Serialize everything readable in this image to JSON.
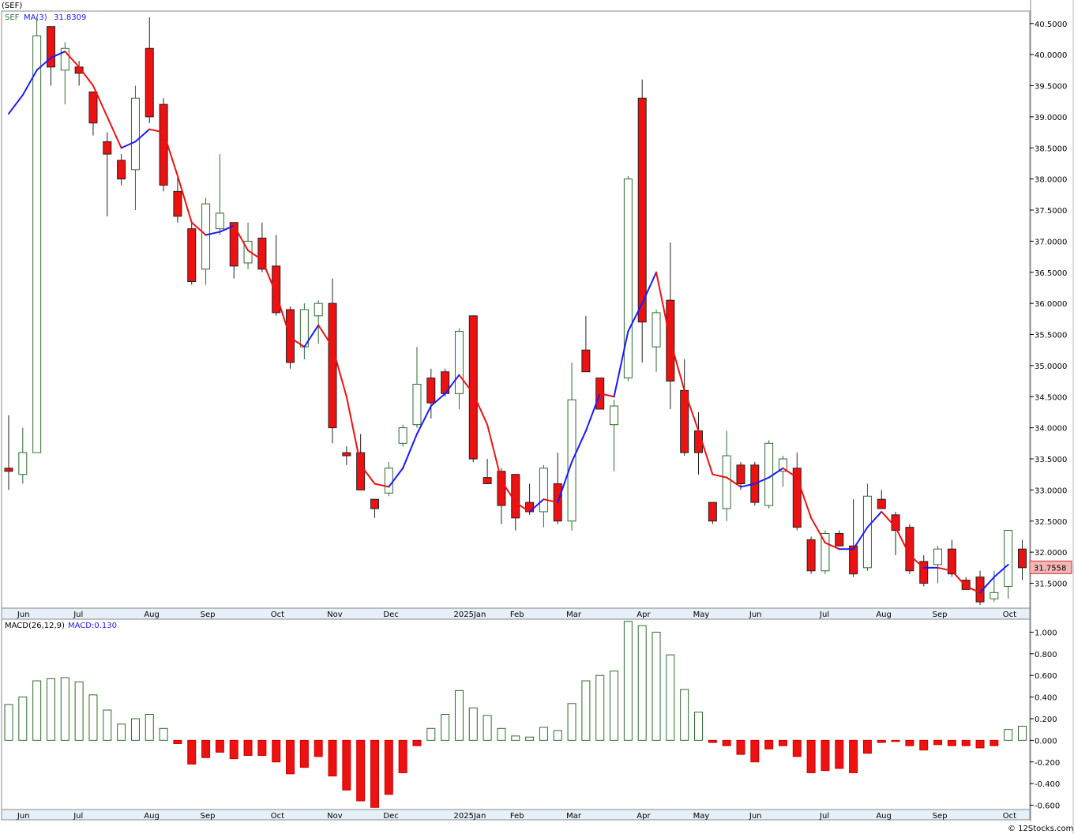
{
  "chart_data": [
    {
      "type": "candlestick",
      "title": "(SEF)",
      "legend": [
        {
          "text": "SEF",
          "color": "#2e7d32"
        },
        {
          "text": "MA(3)",
          "color": "#1a1aff"
        },
        {
          "text": "31.8309",
          "color": "#1a1aff"
        }
      ],
      "last_price_label": "31.7558",
      "last_price": 31.7558,
      "ylim": [
        31.1,
        40.7
      ],
      "y_ticks": [
        "40.5000",
        "40.0000",
        "39.5000",
        "39.0000",
        "38.5000",
        "38.0000",
        "37.5000",
        "37.0000",
        "36.5000",
        "36.0000",
        "35.5000",
        "35.0000",
        "34.5000",
        "34.0000",
        "33.5000",
        "33.0000",
        "32.5000",
        "32.0000",
        "31.5000"
      ],
      "y_tick_values": [
        40.5,
        40.0,
        39.5,
        39.0,
        38.5,
        38.0,
        37.5,
        37.0,
        36.5,
        36.0,
        35.5,
        35.0,
        34.5,
        34.0,
        33.5,
        33.0,
        32.5,
        32.0,
        31.5
      ],
      "x_labels": [
        "Jun",
        "Jul",
        "Aug",
        "Sep",
        "Oct",
        "Nov",
        "Dec",
        "2025Jan",
        "Feb",
        "Mar",
        "Apr",
        "May",
        "Jun",
        "Jul",
        "Aug",
        "Sep",
        "Oct"
      ],
      "x_label_index": [
        1,
        5,
        10,
        14,
        19,
        23,
        27,
        32,
        36,
        40,
        45,
        49,
        53,
        58,
        62,
        66,
        71
      ],
      "candles": [
        {
          "o": 33.35,
          "h": 34.2,
          "l": 33.0,
          "c": 33.3
        },
        {
          "o": 33.25,
          "h": 34.0,
          "l": 33.1,
          "c": 33.6
        },
        {
          "o": 33.6,
          "h": 40.6,
          "l": 39.6,
          "c": 40.3
        },
        {
          "o": 40.45,
          "h": 40.45,
          "l": 39.5,
          "c": 39.8
        },
        {
          "o": 39.75,
          "h": 40.2,
          "l": 39.2,
          "c": 40.1
        },
        {
          "o": 39.8,
          "h": 39.9,
          "l": 39.5,
          "c": 39.7
        },
        {
          "o": 39.4,
          "h": 39.4,
          "l": 38.7,
          "c": 38.9
        },
        {
          "o": 38.6,
          "h": 38.75,
          "l": 37.4,
          "c": 38.4
        },
        {
          "o": 38.3,
          "h": 38.4,
          "l": 37.9,
          "c": 38.0
        },
        {
          "o": 38.15,
          "h": 39.5,
          "l": 37.5,
          "c": 39.3
        },
        {
          "o": 40.1,
          "h": 40.6,
          "l": 38.9,
          "c": 39.0
        },
        {
          "o": 39.2,
          "h": 39.3,
          "l": 37.8,
          "c": 37.9
        },
        {
          "o": 37.8,
          "h": 38.05,
          "l": 37.3,
          "c": 37.4
        },
        {
          "o": 37.2,
          "h": 37.3,
          "l": 36.3,
          "c": 36.35
        },
        {
          "o": 36.55,
          "h": 37.7,
          "l": 36.3,
          "c": 37.6
        },
        {
          "o": 37.2,
          "h": 38.4,
          "l": 37.1,
          "c": 37.45
        },
        {
          "o": 37.3,
          "h": 37.3,
          "l": 36.4,
          "c": 36.6
        },
        {
          "o": 36.65,
          "h": 37.3,
          "l": 36.55,
          "c": 37.0
        },
        {
          "o": 37.05,
          "h": 37.3,
          "l": 36.5,
          "c": 36.55
        },
        {
          "o": 36.6,
          "h": 37.1,
          "l": 35.8,
          "c": 35.85
        },
        {
          "o": 35.9,
          "h": 35.95,
          "l": 34.95,
          "c": 35.05
        },
        {
          "o": 35.3,
          "h": 36.0,
          "l": 35.1,
          "c": 35.9
        },
        {
          "o": 35.8,
          "h": 36.05,
          "l": 35.35,
          "c": 36.0
        },
        {
          "o": 36.0,
          "h": 36.4,
          "l": 33.75,
          "c": 34.0
        },
        {
          "o": 33.6,
          "h": 33.7,
          "l": 33.4,
          "c": 33.55
        },
        {
          "o": 33.6,
          "h": 33.9,
          "l": 33.0,
          "c": 33.0
        },
        {
          "o": 32.85,
          "h": 32.85,
          "l": 32.55,
          "c": 32.7
        },
        {
          "o": 32.95,
          "h": 33.45,
          "l": 32.9,
          "c": 33.35
        },
        {
          "o": 33.75,
          "h": 34.05,
          "l": 33.7,
          "c": 34.0
        },
        {
          "o": 34.05,
          "h": 35.3,
          "l": 34.0,
          "c": 34.7
        },
        {
          "o": 34.8,
          "h": 34.95,
          "l": 34.15,
          "c": 34.4
        },
        {
          "o": 34.9,
          "h": 34.95,
          "l": 34.5,
          "c": 34.55
        },
        {
          "o": 34.55,
          "h": 35.6,
          "l": 34.3,
          "c": 35.55
        },
        {
          "o": 35.8,
          "h": 35.8,
          "l": 33.45,
          "c": 33.5
        },
        {
          "o": 33.2,
          "h": 33.5,
          "l": 33.1,
          "c": 33.1
        },
        {
          "o": 33.3,
          "h": 33.35,
          "l": 32.45,
          "c": 32.75
        },
        {
          "o": 33.25,
          "h": 33.25,
          "l": 32.35,
          "c": 32.55
        },
        {
          "o": 32.8,
          "h": 33.1,
          "l": 32.6,
          "c": 32.65
        },
        {
          "o": 32.65,
          "h": 33.4,
          "l": 32.4,
          "c": 33.35
        },
        {
          "o": 33.1,
          "h": 33.6,
          "l": 32.45,
          "c": 32.5
        },
        {
          "o": 32.5,
          "h": 35.05,
          "l": 32.35,
          "c": 34.45
        },
        {
          "o": 35.25,
          "h": 35.8,
          "l": 34.9,
          "c": 34.9
        },
        {
          "o": 34.8,
          "h": 34.8,
          "l": 34.3,
          "c": 34.3
        },
        {
          "o": 34.05,
          "h": 34.45,
          "l": 33.3,
          "c": 34.35
        },
        {
          "o": 34.8,
          "h": 38.05,
          "l": 34.75,
          "c": 38.0
        },
        {
          "o": 39.3,
          "h": 39.6,
          "l": 35.05,
          "c": 35.7
        },
        {
          "o": 35.3,
          "h": 35.9,
          "l": 34.9,
          "c": 35.85
        },
        {
          "o": 36.05,
          "h": 36.98,
          "l": 34.3,
          "c": 34.75
        },
        {
          "o": 34.6,
          "h": 35.1,
          "l": 33.55,
          "c": 33.6
        },
        {
          "o": 33.95,
          "h": 34.25,
          "l": 33.25,
          "c": 33.6
        },
        {
          "o": 32.8,
          "h": 32.8,
          "l": 32.45,
          "c": 32.5
        },
        {
          "o": 32.7,
          "h": 33.95,
          "l": 32.5,
          "c": 33.55
        },
        {
          "o": 33.4,
          "h": 33.45,
          "l": 33.0,
          "c": 33.1
        },
        {
          "o": 33.4,
          "h": 33.45,
          "l": 32.75,
          "c": 32.8
        },
        {
          "o": 32.75,
          "h": 33.8,
          "l": 32.7,
          "c": 33.75
        },
        {
          "o": 33.3,
          "h": 33.55,
          "l": 33.05,
          "c": 33.5
        },
        {
          "o": 33.35,
          "h": 33.6,
          "l": 32.35,
          "c": 32.4
        },
        {
          "o": 32.2,
          "h": 32.25,
          "l": 31.65,
          "c": 31.7
        },
        {
          "o": 31.7,
          "h": 32.35,
          "l": 31.65,
          "c": 32.3
        },
        {
          "o": 32.3,
          "h": 32.35,
          "l": 32.1,
          "c": 32.1
        },
        {
          "o": 32.1,
          "h": 32.85,
          "l": 31.6,
          "c": 31.65
        },
        {
          "o": 31.75,
          "h": 33.1,
          "l": 31.7,
          "c": 32.9
        },
        {
          "o": 32.85,
          "h": 33.0,
          "l": 32.7,
          "c": 32.7
        },
        {
          "o": 32.6,
          "h": 32.65,
          "l": 31.95,
          "c": 32.35
        },
        {
          "o": 32.4,
          "h": 32.45,
          "l": 31.65,
          "c": 31.7
        },
        {
          "o": 31.85,
          "h": 31.95,
          "l": 31.45,
          "c": 31.5
        },
        {
          "o": 31.8,
          "h": 32.1,
          "l": 31.5,
          "c": 32.05
        },
        {
          "o": 32.05,
          "h": 32.2,
          "l": 31.6,
          "c": 31.65
        },
        {
          "o": 31.55,
          "h": 31.6,
          "l": 31.4,
          "c": 31.4
        },
        {
          "o": 31.6,
          "h": 31.7,
          "l": 31.15,
          "c": 31.2
        },
        {
          "o": 31.25,
          "h": 31.7,
          "l": 31.2,
          "c": 31.35
        },
        {
          "o": 31.45,
          "h": 32.35,
          "l": 31.25,
          "c": 32.35
        },
        {
          "o": 32.05,
          "h": 32.2,
          "l": 31.55,
          "c": 31.75
        }
      ],
      "ma3": [
        39.05,
        39.35,
        39.75,
        39.95,
        40.05,
        39.8,
        39.5,
        39.0,
        38.5,
        38.6,
        38.8,
        38.75,
        38.05,
        37.3,
        37.1,
        37.15,
        37.25,
        36.85,
        36.7,
        36.15,
        35.45,
        35.3,
        35.65,
        35.3,
        34.5,
        33.4,
        33.1,
        33.05,
        33.35,
        33.9,
        34.35,
        34.55,
        34.85,
        34.55,
        34.05,
        33.15,
        32.8,
        32.65,
        32.85,
        32.8,
        33.45,
        33.95,
        34.55,
        34.5,
        35.55,
        36.0,
        36.5,
        35.4,
        34.6,
        33.95,
        33.25,
        33.2,
        33.05,
        33.1,
        33.2,
        33.35,
        33.2,
        32.55,
        32.15,
        32.05,
        32.05,
        32.4,
        32.65,
        32.4,
        31.95,
        31.75,
        31.75,
        31.7,
        31.45,
        31.35,
        31.6,
        31.8
      ],
      "ma3_start_index": 0
    },
    {
      "type": "bar",
      "title": "MACD(26,12,9)",
      "legend": [
        {
          "text": "MACD(26,12,9)",
          "color": "#000000"
        },
        {
          "text": "MACD:0.130",
          "color": "#1a1aff"
        }
      ],
      "ylim": [
        -0.64,
        1.12
      ],
      "y_ticks": [
        "1.000",
        "0.800",
        "0.600",
        "0.400",
        "0.200",
        "0.000",
        "-0.200",
        "-0.400",
        "-0.600"
      ],
      "y_tick_values": [
        1.0,
        0.8,
        0.6,
        0.4,
        0.2,
        0.0,
        -0.2,
        -0.4,
        -0.6
      ],
      "values": [
        0.33,
        0.4,
        0.55,
        0.57,
        0.58,
        0.54,
        0.42,
        0.28,
        0.15,
        0.2,
        0.24,
        0.11,
        -0.03,
        -0.22,
        -0.16,
        -0.11,
        -0.17,
        -0.14,
        -0.14,
        -0.2,
        -0.31,
        -0.25,
        -0.15,
        -0.33,
        -0.46,
        -0.56,
        -0.62,
        -0.5,
        -0.3,
        -0.05,
        0.11,
        0.24,
        0.46,
        0.3,
        0.23,
        0.11,
        0.04,
        0.03,
        0.12,
        0.09,
        0.34,
        0.55,
        0.6,
        0.64,
        1.1,
        1.06,
        1.0,
        0.79,
        0.47,
        0.26,
        -0.02,
        -0.05,
        -0.13,
        -0.2,
        -0.08,
        -0.05,
        -0.15,
        -0.3,
        -0.28,
        -0.26,
        -0.3,
        -0.12,
        -0.02,
        -0.01,
        -0.05,
        -0.09,
        -0.04,
        -0.05,
        -0.05,
        -0.07,
        -0.05,
        0.1,
        0.13
      ]
    }
  ],
  "watermark": "© 12Stocks.com"
}
